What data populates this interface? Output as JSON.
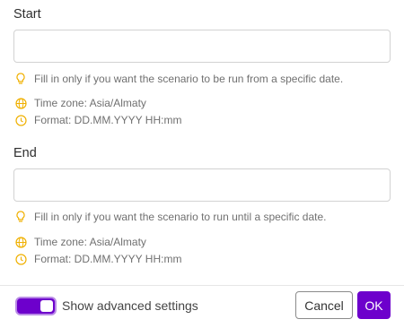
{
  "start": {
    "label": "Start",
    "value": "",
    "hint": "Fill in only if you want the scenario to be run from a specific date.",
    "timezone": "Time zone: Asia/Almaty",
    "format": "Format: DD.MM.YYYY HH:mm"
  },
  "end": {
    "label": "End",
    "value": "",
    "hint": "Fill in only if you want the scenario to run until a specific date.",
    "timezone": "Time zone: Asia/Almaty",
    "format": "Format: DD.MM.YYYY HH:mm"
  },
  "footer": {
    "advanced_label": "Show advanced settings",
    "advanced_enabled": true,
    "cancel_label": "Cancel",
    "ok_label": "OK"
  },
  "colors": {
    "accent": "#6d00cc",
    "hint_icon": "#f0b000"
  },
  "icons": {
    "hint": "lightbulb-icon",
    "timezone": "globe-icon",
    "format": "clock-icon"
  }
}
